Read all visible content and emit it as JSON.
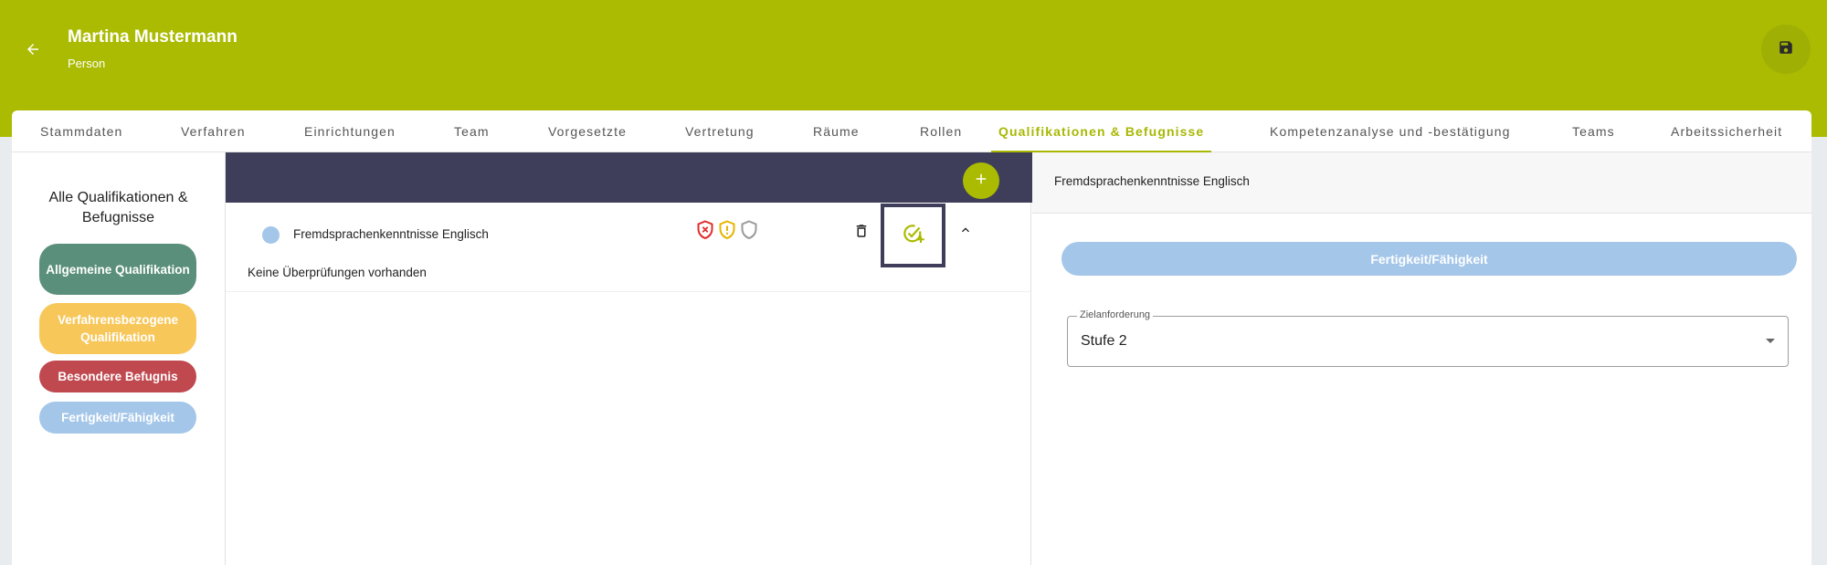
{
  "header": {
    "title": "Martina Mustermann",
    "subtitle": "Person",
    "back_icon": "arrow-left-icon",
    "save_icon": "floppy-disk-icon"
  },
  "tabs": [
    {
      "label": "Stammdaten",
      "active": false
    },
    {
      "label": "Verfahren",
      "active": false
    },
    {
      "label": "Einrichtungen",
      "active": false
    },
    {
      "label": "Team",
      "active": false
    },
    {
      "label": "Vorgesetzte",
      "active": false
    },
    {
      "label": "Vertretung",
      "active": false
    },
    {
      "label": "Räume",
      "active": false
    },
    {
      "label": "Rollen",
      "active": false
    },
    {
      "label": "Qualifikationen & Befugnisse",
      "active": true
    },
    {
      "label": "Kompetenzanalyse und -bestätigung",
      "active": false
    },
    {
      "label": "Teams",
      "active": false
    },
    {
      "label": "Arbeitssicherheit",
      "active": false
    }
  ],
  "sidebar": {
    "title": "Alle Qualifikationen & Befugnisse",
    "categories": [
      {
        "label": "Allgemeine Qualifikation",
        "color": "#5a8f7b"
      },
      {
        "label": "Verfahrensbezogene Qualifikation",
        "color": "#f7c75a"
      },
      {
        "label": "Besondere Befugnis",
        "color": "#c0484f"
      },
      {
        "label": "Fertigkeit/Fähigkeit",
        "color": "#a4c6e9"
      }
    ]
  },
  "list": {
    "items": [
      {
        "label": "Fremdsprachenkenntnisse Englisch",
        "dot_color": "#a4c6e9",
        "status_icons": [
          "shield-error-icon",
          "shield-warning-icon",
          "shield-outline-icon"
        ],
        "detail": "Keine Überprüfungen vorhanden"
      }
    ]
  },
  "detail": {
    "title": "Fremdsprachenkenntnisse Englisch",
    "type_label": "Fertigkeit/Fähigkeit",
    "target_label": "Zielanforderung",
    "target_value": "Stufe 2"
  },
  "colors": {
    "accent": "#abbb02",
    "dark_bar": "#3f3e5a"
  }
}
